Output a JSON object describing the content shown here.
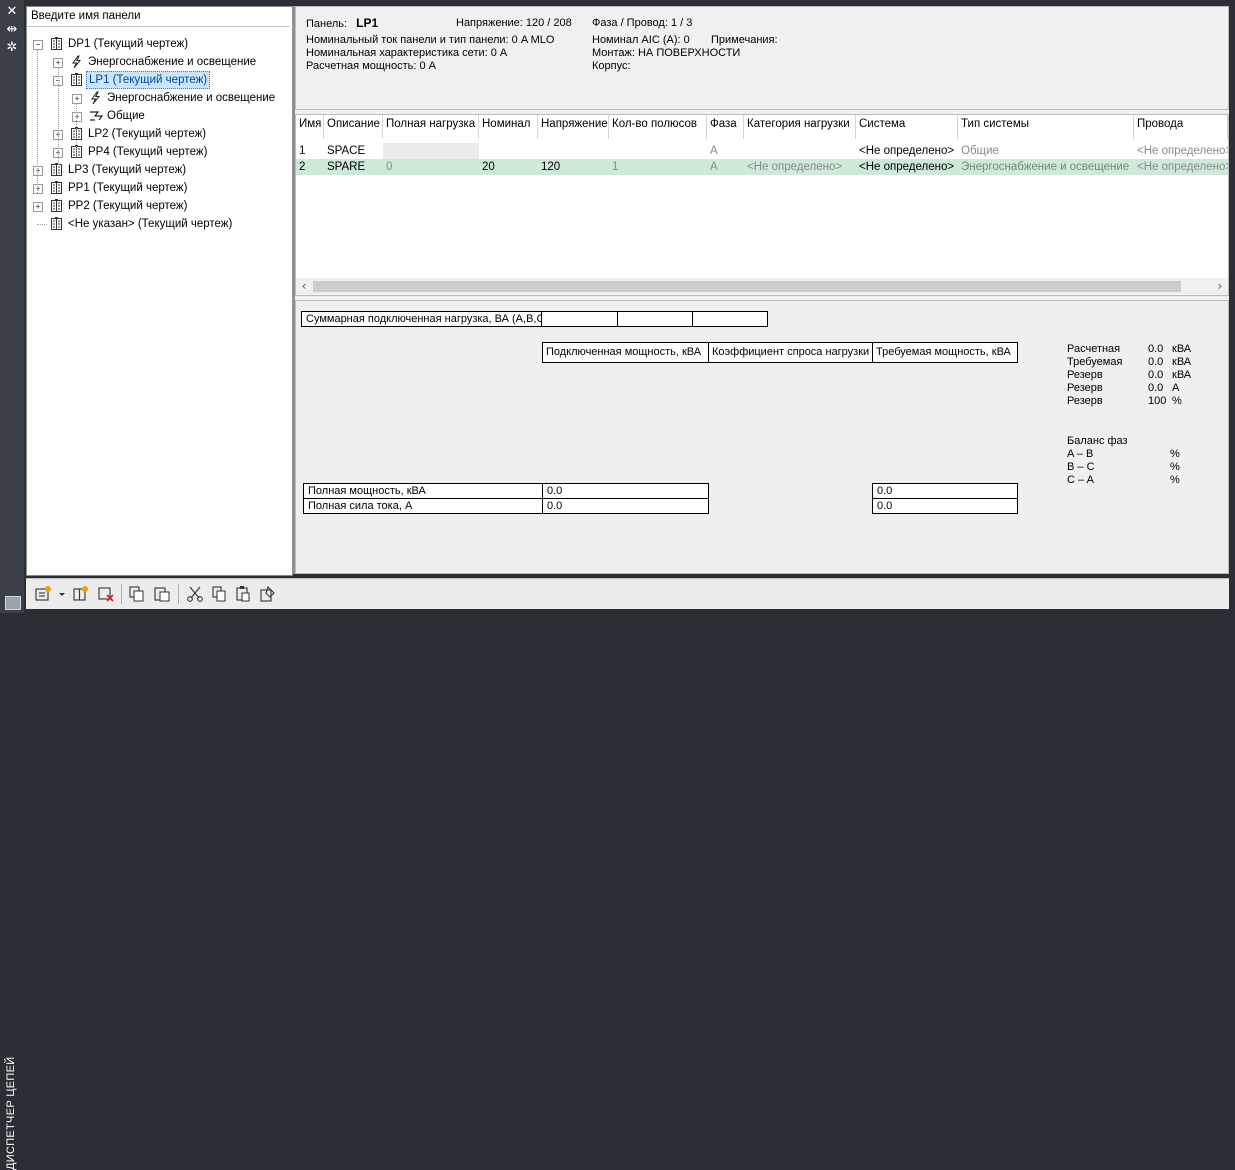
{
  "sidebar": {
    "title": "ДИСПЕТЧЕР ЦЕПЕЙ",
    "close_icon": "close-icon",
    "pin_icon": "pin-icon",
    "settings_icon": "settings-icon"
  },
  "search": {
    "placeholder": "Введите имя панели"
  },
  "tree": [
    {
      "label": "DP1 (Текущий чертеж)",
      "level": 0,
      "icon": "panel-icon",
      "expander": "−"
    },
    {
      "label": "Энергоснабжение и освещение",
      "level": 1,
      "icon": "lightning-icon",
      "expander": "+"
    },
    {
      "label": "LP1 (Текущий чертеж)",
      "level": 1,
      "icon": "panel-icon",
      "expander": "−",
      "selected": true
    },
    {
      "label": "Энергоснабжение и освещение",
      "level": 2,
      "icon": "lightning-icon",
      "expander": "+"
    },
    {
      "label": "Общие",
      "level": 2,
      "icon": "general-icon",
      "expander": "+"
    },
    {
      "label": "LP2 (Текущий чертеж)",
      "level": 1,
      "icon": "panel-icon",
      "expander": "+"
    },
    {
      "label": "PP4 (Текущий чертеж)",
      "level": 1,
      "icon": "panel-icon",
      "expander": "+"
    },
    {
      "label": "LP3 (Текущий чертеж)",
      "level": 0,
      "icon": "panel-icon",
      "expander": "+"
    },
    {
      "label": "PP1 (Текущий чертеж)",
      "level": 0,
      "icon": "panel-icon",
      "expander": "+"
    },
    {
      "label": "PP2 (Текущий чертеж)",
      "level": 0,
      "icon": "panel-icon",
      "expander": "+"
    },
    {
      "label": "<Не указан> (Текущий чертеж)",
      "level": 0,
      "icon": "panel-icon",
      "expander": ""
    }
  ],
  "panel_info": {
    "panel_label": "Панель:",
    "panel_value": "LP1",
    "voltage": "Напряжение: 120 / 208",
    "phase_wire": "Фаза / Провод:   1 /  3",
    "rated_current": "Номинальный ток панели и тип панели: 0 A MLO",
    "aic": "Номинал AIC (A):   0",
    "notes": "Примечания:",
    "network_rating": "Номинальная характеристика сети: 0 A",
    "mounting": "Монтаж:  НА ПОВЕРХНОСТИ",
    "design_power": "Расчетная мощность: 0 A",
    "enclosure": "Корпус:"
  },
  "grid": {
    "columns": [
      "Имя",
      "Описание",
      "Полная нагрузка",
      "Номинал",
      "Напряжение",
      "Кол-во полюсов",
      "Фаза",
      "Категория нагрузки",
      "Система",
      "Тип системы",
      "Провода"
    ],
    "rows": [
      [
        "1",
        "SPACE",
        "",
        "",
        "",
        "",
        "A",
        "",
        "<Не определено>",
        "Общие",
        "<Не определено>"
      ],
      [
        "2",
        "SPARE",
        "0",
        "20",
        "120",
        "1",
        "A",
        "<Не определено>",
        "<Не определено>",
        "Энергоснабжение и освещение",
        "<Не определено>"
      ]
    ],
    "row_highlight_color": "#cfe9d9"
  },
  "summary": {
    "connected_load_label": "Суммарная подключенная нагрузка, ВА (A,B,C)",
    "col_connected": "Подключенная мощность, кВА",
    "col_demand": "Коэффициент спроса нагрузки",
    "col_required": "Требуемая мощность, кВА",
    "total_power_label": "Полная мощность, кВА",
    "total_current_label": "Полная сила тока, A",
    "total_power_value": "0.0",
    "total_current_value": "0.0",
    "required_power_value": "0.0",
    "required_current_value": "0.0",
    "stats": [
      {
        "label": "Расчетная",
        "value": "0.0",
        "unit": "кВА"
      },
      {
        "label": "Требуемая",
        "value": "0.0",
        "unit": "кВА"
      },
      {
        "label": "Резерв",
        "value": "0.0",
        "unit": "кВА"
      },
      {
        "label": "Резерв",
        "value": "0.0",
        "unit": "A"
      },
      {
        "label": "Резерв",
        "value": "100",
        "unit": "%"
      }
    ],
    "balance_title": "Баланс фаз",
    "balance": [
      {
        "label": "A – B",
        "unit": "%"
      },
      {
        "label": "B – C",
        "unit": "%"
      },
      {
        "label": "C – A",
        "unit": "%"
      }
    ]
  },
  "toolbar": {
    "buttons": [
      "new-panel-icon",
      "dropdown-arrow-icon",
      "new-circuit-icon",
      "delete-icon",
      "copy-panel-icon",
      "paste-panel-icon",
      "cut-icon",
      "copy-icon",
      "paste-icon",
      "properties-icon"
    ]
  }
}
